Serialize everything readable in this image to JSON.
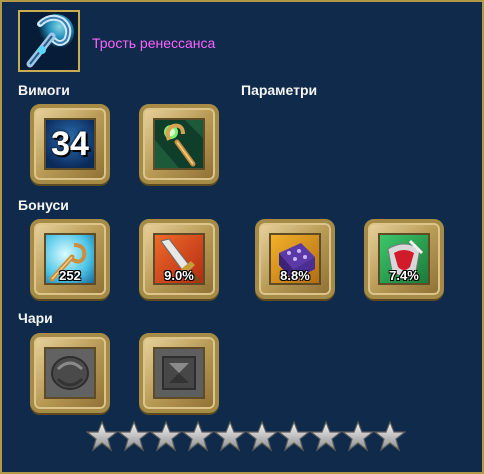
{
  "item": {
    "name": "Трость ренессанса",
    "icon": "renaissance-cane-icon"
  },
  "sections": {
    "requirements_label": "Вимоги",
    "parameters_label": "Параметри",
    "bonuses_label": "Бонуси",
    "charms_label": "Чари"
  },
  "requirements": {
    "level": "34"
  },
  "parameters": [
    {
      "icon": "staff-weapon-type-icon"
    }
  ],
  "bonuses": [
    {
      "icon": "magic-cane-icon",
      "value": "252"
    },
    {
      "icon": "sword-attack-icon",
      "value": "9.0%"
    },
    {
      "icon": "dice-luck-icon",
      "value": "8.8%"
    },
    {
      "icon": "critical-shield-icon",
      "value": "7.4%"
    }
  ],
  "charms": [
    {
      "icon": "empty-round-charm-icon"
    },
    {
      "icon": "empty-square-charm-icon"
    }
  ],
  "stars": {
    "filled": 0,
    "total": 10
  },
  "colors": {
    "panel_background": "#0f2a4a",
    "item_name": "#ff63ff",
    "frame_gold": "#b49a48"
  }
}
